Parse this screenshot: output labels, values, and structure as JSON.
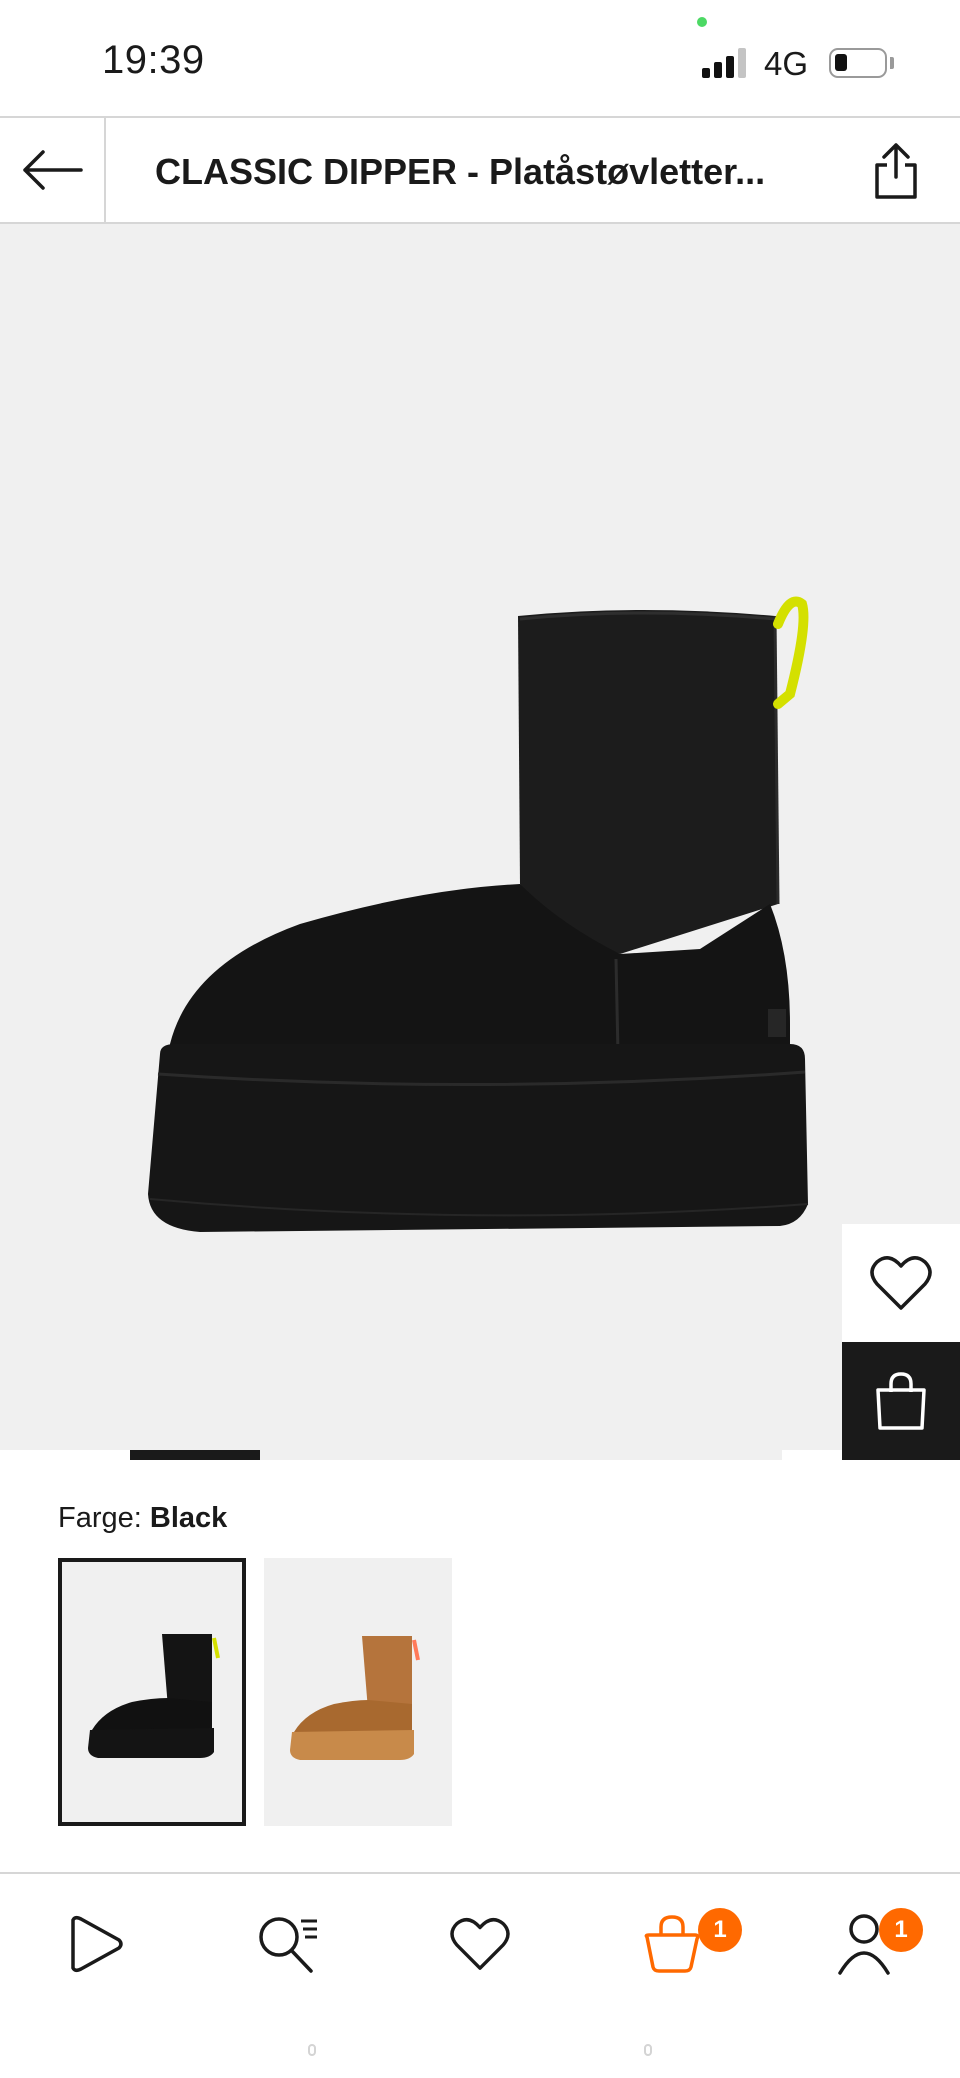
{
  "status_bar": {
    "time": "19:39",
    "network": "4G",
    "signal_bars_active": 3,
    "signal_bars_total": 4,
    "battery_level": 0.25
  },
  "header": {
    "title": "CLASSIC DIPPER - Platåstøvletter...",
    "back_icon": "arrow-left-icon",
    "share_icon": "share-icon"
  },
  "product": {
    "image_alt": "Black platform boot",
    "actions": {
      "wishlist_icon": "heart-icon",
      "add_to_bag_icon": "shopping-bag-icon"
    },
    "carousel": {
      "active_index": 1,
      "image_count": 5
    }
  },
  "color": {
    "label": "Farge:",
    "selected": "Black",
    "options": [
      {
        "name": "Black",
        "selected": true,
        "shade": "#111111",
        "accent": "#d4e000"
      },
      {
        "name": "Chestnut",
        "selected": false,
        "shade": "#b5743c",
        "accent": "#ff7a59"
      }
    ]
  },
  "bottom_nav": {
    "items": [
      {
        "icon": "play-icon",
        "active": false
      },
      {
        "icon": "search-list-icon",
        "active": false
      },
      {
        "icon": "heart-icon",
        "active": false
      },
      {
        "icon": "bag-icon",
        "active": true,
        "badge": "1"
      },
      {
        "icon": "profile-icon",
        "active": false,
        "badge": "1"
      }
    ]
  },
  "colors": {
    "accent": "#ff6900",
    "image_background": "#f0f0f0",
    "text": "#1a1a1a"
  }
}
